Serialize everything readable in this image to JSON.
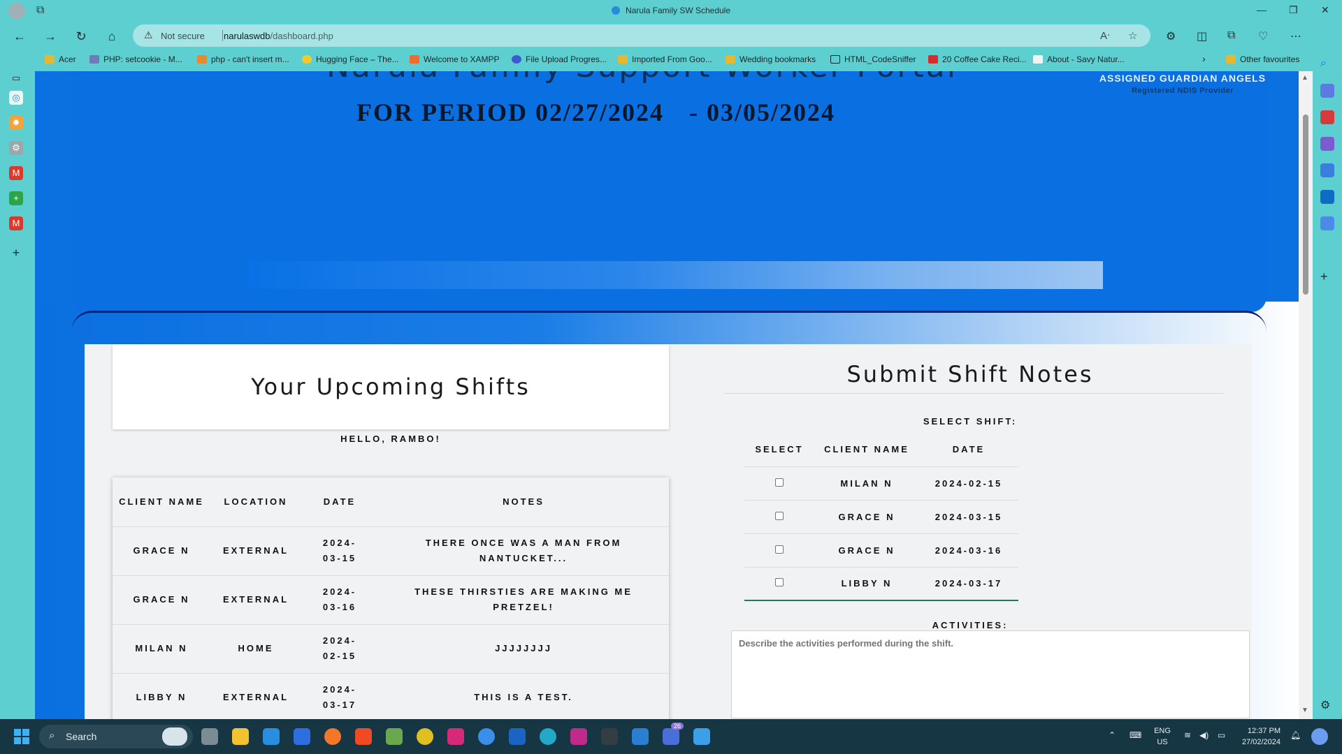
{
  "browser": {
    "window_title": "Narula Family SW Schedule",
    "security_label": "Not secure",
    "url_host": "narulaswdb",
    "url_path": "/dashboard.php",
    "bookmarks": [
      "Acer",
      "PHP: setcookie - M...",
      "php - can't insert m...",
      "Hugging Face – The...",
      "Welcome to XAMPP",
      "File Upload Progres...",
      "Imported From Goo...",
      "Wedding bookmarks",
      "HTML_CodeSniffer",
      "20 Coffee Cake Reci...",
      "About - Savy Natur..."
    ],
    "other_favourites": "Other favourites"
  },
  "header": {
    "portal_title": "Narula Family Support Worker Portal",
    "period_label": "FOR PERIOD 02/27/2024",
    "period_end": "- 03/05/2024",
    "logo_name": "ASSIGNED GUARDIAN ANGELS",
    "logo_tagline": "Registered NDIS Provider"
  },
  "upcoming": {
    "title": "Your Upcoming Shifts",
    "greeting": "HELLO, RAMBO!",
    "columns": [
      "CLIENT NAME",
      "LOCATION",
      "DATE",
      "NOTES"
    ],
    "rows": [
      {
        "client": "GRACE N",
        "location": "EXTERNAL",
        "date": "2024-03-15",
        "notes": "THERE ONCE WAS A MAN FROM NANTUCKET..."
      },
      {
        "client": "GRACE N",
        "location": "EXTERNAL",
        "date": "2024-03-16",
        "notes": "THESE THIRSTIES ARE MAKING ME PRETZEL!"
      },
      {
        "client": "MILAN N",
        "location": "HOME",
        "date": "2024-02-15",
        "notes": "JJJJJJJJ"
      },
      {
        "client": "LIBBY N",
        "location": "EXTERNAL",
        "date": "2024-03-17",
        "notes": "THIS IS A TEST."
      }
    ]
  },
  "submit": {
    "title": "Submit Shift Notes",
    "select_shift_label": "SELECT SHIFT:",
    "columns": [
      "SELECT",
      "CLIENT NAME",
      "DATE"
    ],
    "rows": [
      {
        "client": "MILAN N",
        "date": "2024-02-15"
      },
      {
        "client": "GRACE N",
        "date": "2024-03-15"
      },
      {
        "client": "GRACE N",
        "date": "2024-03-16"
      },
      {
        "client": "LIBBY N",
        "date": "2024-03-17"
      }
    ],
    "activities_label": "ACTIVITIES:",
    "activities_placeholder": "Describe the activities performed during the shift."
  },
  "taskbar": {
    "search_label": "Search",
    "lang_line1": "ENG",
    "lang_line2": "US",
    "time": "12:37 PM",
    "date": "27/02/2024",
    "badge_count": "26"
  }
}
